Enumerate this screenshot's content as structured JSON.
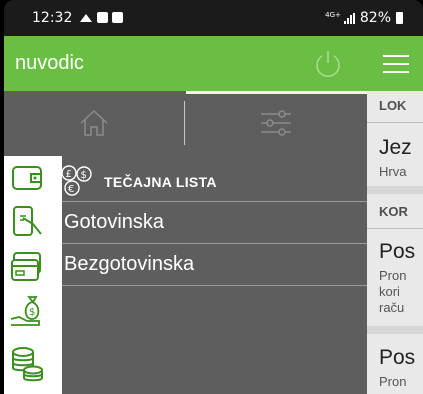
{
  "status": {
    "time": "12:32",
    "network": "4G+",
    "battery": "82%"
  },
  "drawer": {
    "app_title": "nuvodic",
    "section_title": "TEČAJNA LISTA",
    "items": [
      {
        "label": "Gotovinska"
      },
      {
        "label": "Bezgotovinska"
      }
    ]
  },
  "background_page": {
    "sections": [
      {
        "heading": "LOK",
        "title": "Jez",
        "subtitle": "Hrva"
      },
      {
        "heading": "KOR",
        "title": "Pos",
        "lines": [
          "Pron",
          "kori",
          "raču"
        ]
      },
      {
        "title": "Pos",
        "lines": [
          "Pron"
        ]
      }
    ]
  },
  "colors": {
    "accent_green": "#6bbe44",
    "drawer_bg": "#5e5e5e",
    "rail_bg": "#ffffff",
    "icon_green": "#3b8f1f"
  },
  "icons": {
    "power": "power-icon",
    "home": "home-icon",
    "settings": "sliders-icon",
    "menu": "hamburger-menu-icon",
    "currency": "currency-icon",
    "rail": [
      "wallet-icon",
      "phone-payment-icon",
      "credit-card-icon",
      "money-bag-hand-icon",
      "coins-stack-icon"
    ]
  }
}
